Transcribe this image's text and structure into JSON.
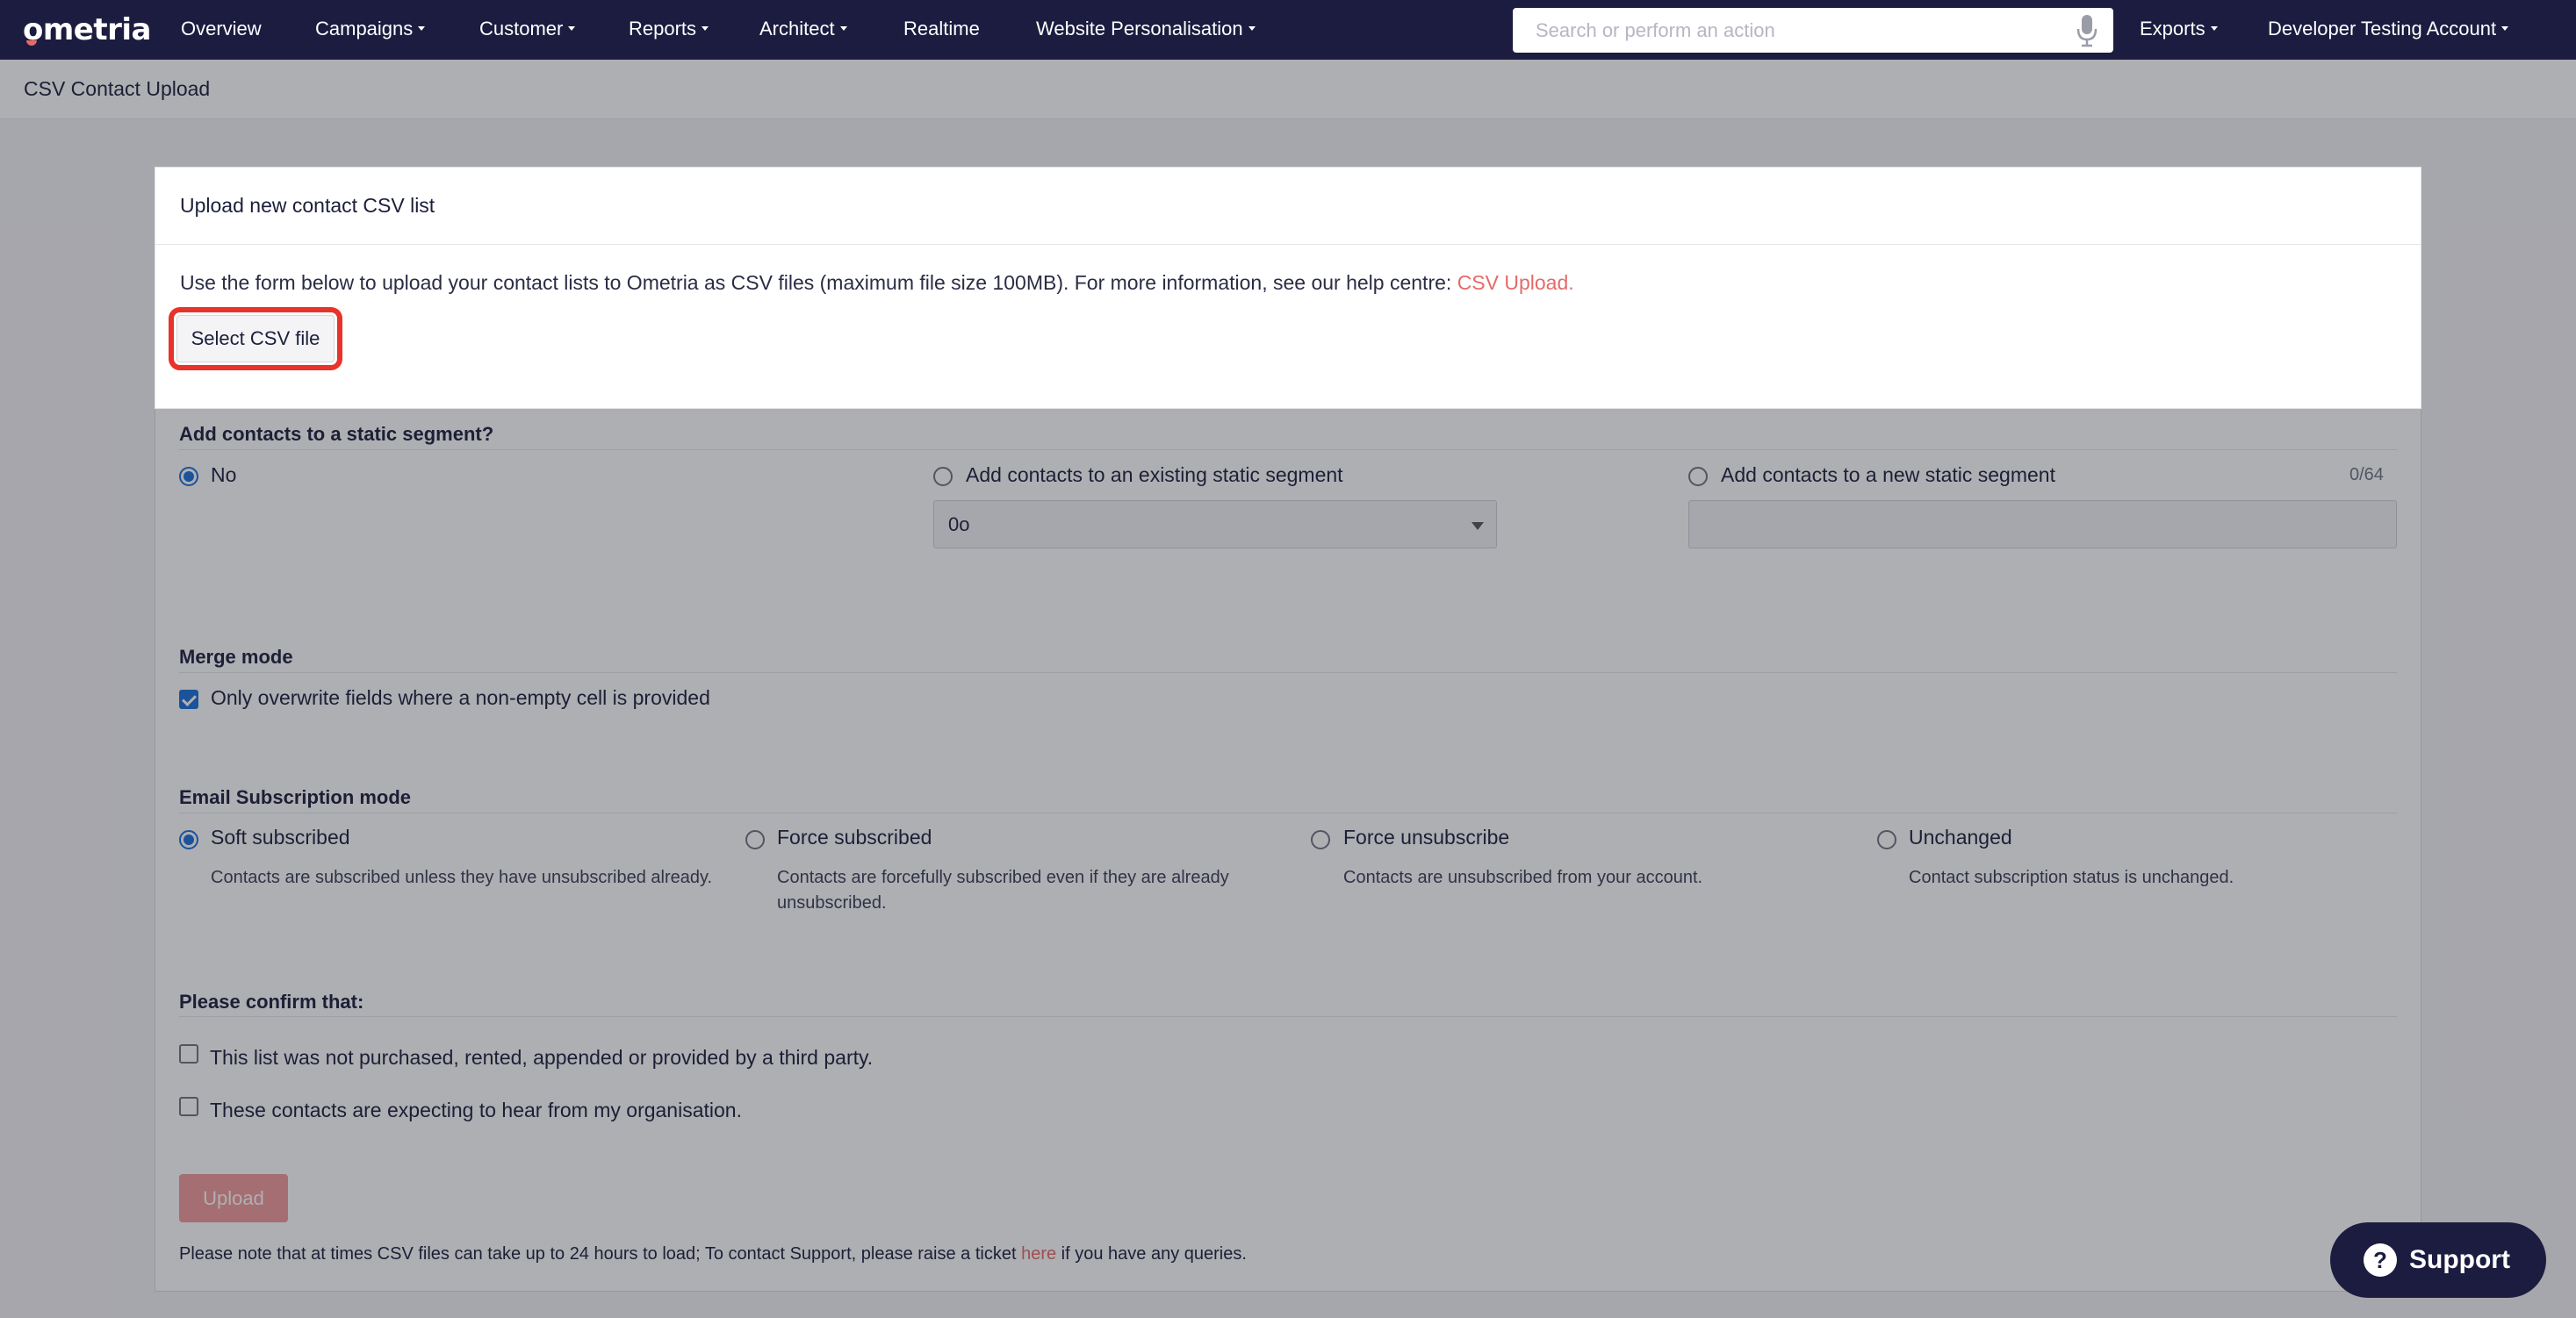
{
  "nav": {
    "logo": "ometria",
    "items": [
      {
        "label": "Overview",
        "dropdown": false
      },
      {
        "label": "Campaigns",
        "dropdown": true
      },
      {
        "label": "Customer",
        "dropdown": true
      },
      {
        "label": "Reports",
        "dropdown": true
      },
      {
        "label": "Architect",
        "dropdown": true
      },
      {
        "label": "Realtime",
        "dropdown": false
      },
      {
        "label": "Website Personalisation",
        "dropdown": true
      }
    ],
    "search_placeholder": "Search or perform an action",
    "exports_label": "Exports",
    "account_label": "Developer Testing Account"
  },
  "page": {
    "title": "CSV Contact Upload"
  },
  "upload_panel": {
    "title": "Upload new contact CSV list",
    "text": "Use the form below to upload your contact lists to Ometria as CSV files (maximum file size 100MB). For more information, see our help centre: ",
    "help_link": "CSV Upload.",
    "select_button": "Select CSV file"
  },
  "segment": {
    "title": "Add contacts to a static segment?",
    "options": [
      {
        "label": "No",
        "checked": true
      },
      {
        "label": "Add contacts to an existing static segment",
        "checked": false
      },
      {
        "label": "Add contacts to a new static segment",
        "checked": false
      }
    ],
    "existing_select_value": "0o",
    "new_segment_counter": "0/64"
  },
  "merge": {
    "title": "Merge mode",
    "option_label": "Only overwrite fields where a non-empty cell is provided",
    "checked": true
  },
  "subscription": {
    "title": "Email Subscription mode",
    "options": [
      {
        "label": "Soft subscribed",
        "desc": "Contacts are subscribed unless they have unsubscribed already.",
        "checked": true
      },
      {
        "label": "Force subscribed",
        "desc": "Contacts are forcefully subscribed even if they are already unsubscribed.",
        "checked": false
      },
      {
        "label": "Force unsubscribe",
        "desc": "Contacts are unsubscribed from your account.",
        "checked": false
      },
      {
        "label": "Unchanged",
        "desc": "Contact subscription status is unchanged.",
        "checked": false
      }
    ]
  },
  "confirm": {
    "title": "Please confirm that:",
    "items": [
      {
        "label": "This list was not purchased, rented, appended or provided by a third party.",
        "checked": false
      },
      {
        "label": "These contacts are expecting to hear from my organisation.",
        "checked": false
      }
    ]
  },
  "upload_button": "Upload",
  "note": {
    "before": "Please note that at times CSV files can take up to 24 hours to load; To contact Support, please raise a ticket ",
    "link": "here",
    "after": " if you have any queries."
  },
  "support_button": "Support",
  "colors": {
    "nav_bg": "#1b1c3f",
    "accent_link": "#e56a6a",
    "radio_blue": "#1a6ed8",
    "highlight_red": "#e8322a"
  }
}
